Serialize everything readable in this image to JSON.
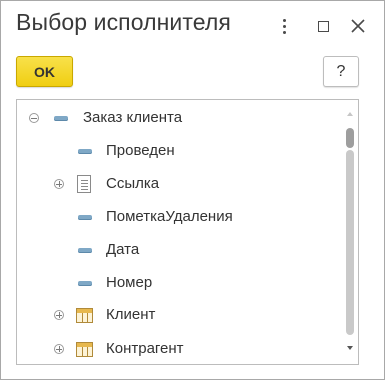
{
  "window": {
    "title": "Выбор исполнителя"
  },
  "toolbar": {
    "ok_label": "OK",
    "help_label": "?"
  },
  "tree": {
    "rows": [
      {
        "label": "Заказ клиента",
        "icon": "attribute-icon",
        "expander": "collapse"
      },
      {
        "label": "Проведен",
        "icon": "attribute-icon",
        "expander": "none"
      },
      {
        "label": "Ссылка",
        "icon": "document-icon",
        "expander": "expand"
      },
      {
        "label": "ПометкаУдаления",
        "icon": "attribute-icon",
        "expander": "none"
      },
      {
        "label": "Дата",
        "icon": "attribute-icon",
        "expander": "none"
      },
      {
        "label": "Номер",
        "icon": "attribute-icon",
        "expander": "none"
      },
      {
        "label": "Клиент",
        "icon": "table-icon",
        "expander": "expand"
      },
      {
        "label": "Контрагент",
        "icon": "table-icon",
        "expander": "expand"
      }
    ]
  },
  "colors": {
    "ok_button": "#f4d62a",
    "attribute_icon": "#7fa8c6",
    "table_icon": "#e7b84e"
  }
}
